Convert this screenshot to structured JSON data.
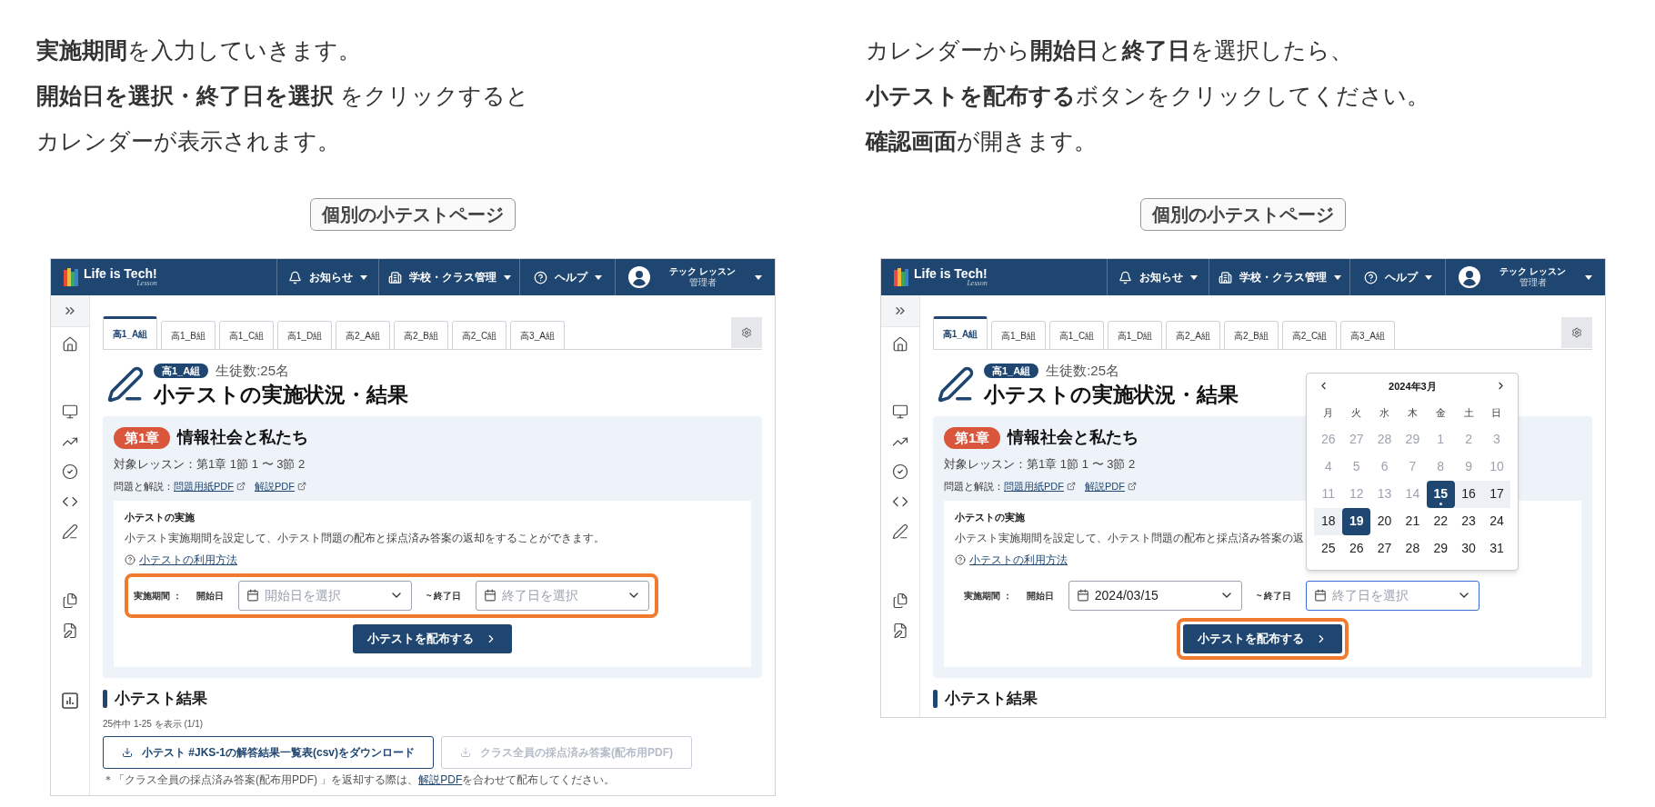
{
  "columns": [
    {
      "instructions": [
        "**実施期間**を入力していきます。",
        "**開始日を選択・終了日を選択** をクリックすると",
        "カレンダーが表示されます。"
      ],
      "caption": "個別の小テストページ",
      "screenshot": {
        "logo": {
          "name": "Life is Tech!",
          "sub": "Lesson"
        },
        "nav": [
          {
            "kind": "bell",
            "label": "お知らせ"
          },
          {
            "kind": "building",
            "label": "学校・クラス管理"
          },
          {
            "kind": "help",
            "label": "ヘルプ"
          }
        ],
        "user": {
          "name": "テック レッスン",
          "role": "管理者"
        },
        "tabs": [
          {
            "label": "高1_A組",
            "selected": true
          },
          {
            "label": "高1_B組",
            "selected": false
          },
          {
            "label": "高1_C組",
            "selected": false
          },
          {
            "label": "高1_D組",
            "selected": false
          },
          {
            "label": "高2_A組",
            "selected": false
          },
          {
            "label": "高2_B組",
            "selected": false
          },
          {
            "label": "高2_C組",
            "selected": false
          },
          {
            "label": "高3_A組",
            "selected": false
          }
        ],
        "class_badge": "高1_A組",
        "student_count": "生徒数:25名",
        "title": "小テストの実施状況・結果",
        "chapter": {
          "badge": "第1章",
          "title": "情報社会と私たち",
          "lessons": "対象レッスン：第1章 1節 1 〜 3節 2",
          "materials_label": "問題と解説：",
          "links": [
            "問題用紙PDF",
            "解説PDF"
          ]
        },
        "implementation": {
          "heading": "小テストの実施",
          "description": "小テスト実施期間を設定して、小テスト問題の配布と採点済み答案の返却をすることができます。",
          "help_link": "小テストの利用方法",
          "period_label": "実施期間 ：",
          "start_label": "開始日",
          "start_field": {
            "placeholder": "開始日を選択",
            "focused": false
          },
          "end_label": "~ 終了日",
          "end_field": {
            "placeholder": "終了日を選択",
            "focused": false
          },
          "dates_highlighted": true,
          "button": {
            "label": "小テストを配布する",
            "highlighted": false
          }
        },
        "results": {
          "heading": "小テスト結果",
          "count": "25件中 1-25 を表示 (1/1)",
          "buttons": [
            {
              "label": "小テスト #JKS-1の解答結果一覧表(csv)をダウンロード",
              "disabled": false
            },
            {
              "label": "クラス全員の採点済み答案(配布用PDF)",
              "disabled": true
            }
          ],
          "note": {
            "before": "＊「クラス全員の採点済み答案(配布用PDF) 」を返却する際は、",
            "link": "解説PDF",
            "after": "を合わせて配布してください。"
          }
        }
      }
    },
    {
      "instructions": [
        "カレンダーから**開始日**と**終了日**を選択したら、",
        "**小テストを配布する**ボタンをクリックしてください。",
        "**確認画面**が開きます。"
      ],
      "caption": "個別の小テストページ",
      "screenshot": {
        "logo": {
          "name": "Life is Tech!",
          "sub": "Lesson"
        },
        "nav": [
          {
            "kind": "bell",
            "label": "お知らせ"
          },
          {
            "kind": "building",
            "label": "学校・クラス管理"
          },
          {
            "kind": "help",
            "label": "ヘルプ"
          }
        ],
        "user": {
          "name": "テック レッスン",
          "role": "管理者"
        },
        "tabs": [
          {
            "label": "高1_A組",
            "selected": true
          },
          {
            "label": "高1_B組",
            "selected": false
          },
          {
            "label": "高1_C組",
            "selected": false
          },
          {
            "label": "高1_D組",
            "selected": false
          },
          {
            "label": "高2_A組",
            "selected": false
          },
          {
            "label": "高2_B組",
            "selected": false
          },
          {
            "label": "高2_C組",
            "selected": false
          },
          {
            "label": "高3_A組",
            "selected": false
          }
        ],
        "class_badge": "高1_A組",
        "student_count": "生徒数:25名",
        "title": "小テストの実施状況・結果",
        "chapter": {
          "badge": "第1章",
          "title": "情報社会と私たち",
          "lessons": "対象レッスン：第1章 1節 1 〜 3節 2",
          "materials_label": "問題と解説：",
          "links": [
            "問題用紙PDF",
            "解説PDF"
          ]
        },
        "implementation": {
          "heading": "小テストの実施",
          "description": "小テスト実施期間を設定して、小テスト問題の配布と採点済み答案の返",
          "help_link": "小テストの利用方法",
          "period_label": "実施期間 ：",
          "start_label": "開始日",
          "start_field": {
            "value": "2024/03/15",
            "focused": false
          },
          "end_label": "~ 終了日",
          "end_field": {
            "placeholder": "終了日を選択",
            "focused": true
          },
          "dates_highlighted": false,
          "calendar": {
            "month": "2024年3月",
            "weekdays": [
              "月",
              "火",
              "水",
              "木",
              "金",
              "土",
              "日"
            ],
            "weeks": [
              [
                {
                  "label": "26",
                  "kind": "muted"
                },
                {
                  "label": "27",
                  "kind": "muted"
                },
                {
                  "label": "28",
                  "kind": "muted"
                },
                {
                  "label": "29",
                  "kind": "muted"
                },
                {
                  "label": "1",
                  "kind": "muted"
                },
                {
                  "label": "2",
                  "kind": "muted"
                },
                {
                  "label": "3",
                  "kind": "muted"
                }
              ],
              [
                {
                  "label": "4",
                  "kind": "muted"
                },
                {
                  "label": "5",
                  "kind": "muted"
                },
                {
                  "label": "6",
                  "kind": "muted"
                },
                {
                  "label": "7",
                  "kind": "muted"
                },
                {
                  "label": "8",
                  "kind": "muted"
                },
                {
                  "label": "9",
                  "kind": "muted"
                },
                {
                  "label": "10",
                  "kind": "muted"
                }
              ],
              [
                {
                  "label": "11",
                  "kind": "muted"
                },
                {
                  "label": "12",
                  "kind": "muted"
                },
                {
                  "label": "13",
                  "kind": "muted"
                },
                {
                  "label": "14",
                  "kind": "muted"
                },
                {
                  "label": "15",
                  "kind": "start"
                },
                {
                  "label": "16",
                  "kind": "range"
                },
                {
                  "label": "17",
                  "kind": "range"
                }
              ],
              [
                {
                  "label": "18",
                  "kind": "range"
                },
                {
                  "label": "19",
                  "kind": "end"
                },
                {
                  "label": "20",
                  "kind": "normal"
                },
                {
                  "label": "21",
                  "kind": "normal"
                },
                {
                  "label": "22",
                  "kind": "normal"
                },
                {
                  "label": "23",
                  "kind": "normal"
                },
                {
                  "label": "24",
                  "kind": "normal"
                }
              ],
              [
                {
                  "label": "25",
                  "kind": "normal"
                },
                {
                  "label": "26",
                  "kind": "normal"
                },
                {
                  "label": "27",
                  "kind": "normal"
                },
                {
                  "label": "28",
                  "kind": "normal"
                },
                {
                  "label": "29",
                  "kind": "normal"
                },
                {
                  "label": "30",
                  "kind": "normal"
                },
                {
                  "label": "31",
                  "kind": "normal"
                }
              ]
            ]
          },
          "button": {
            "label": "小テストを配布する",
            "highlighted": true
          }
        },
        "results": {
          "heading": "小テスト結果"
        }
      }
    }
  ]
}
